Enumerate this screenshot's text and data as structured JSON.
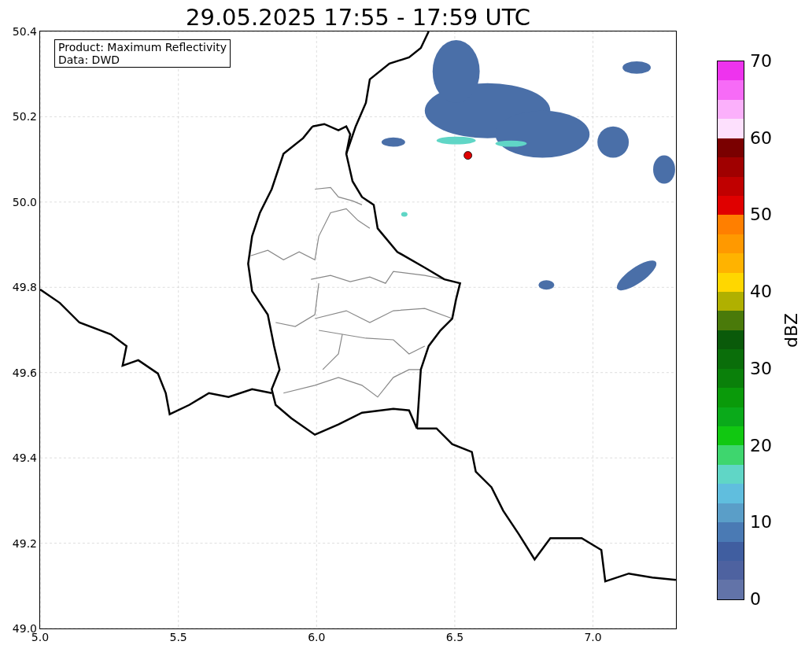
{
  "title": "29.05.2025 17:55 - 17:59 UTC",
  "annotation": [
    "Product: Maximum Reflectivity",
    "Data: DWD"
  ],
  "y_ticks": [
    "50.4",
    "50.2",
    "50.0",
    "49.8",
    "49.6",
    "49.4",
    "49.2",
    "49.0"
  ],
  "x_ticks": [
    "5.0",
    "5.5",
    "6.0",
    "6.5",
    "7.0"
  ],
  "colorbar": {
    "label": "dBZ",
    "ticks": [
      "70",
      "60",
      "50",
      "40",
      "30",
      "20",
      "10",
      "0"
    ],
    "bins": [
      {
        "color": "#ee33ee"
      },
      {
        "color": "#f76bf7"
      },
      {
        "color": "#fbb0fb"
      },
      {
        "color": "#fde0fd"
      },
      {
        "color": "#7a0000"
      },
      {
        "color": "#a00000"
      },
      {
        "color": "#c00000"
      },
      {
        "color": "#e00000"
      },
      {
        "color": "#ff7f00"
      },
      {
        "color": "#ff9900"
      },
      {
        "color": "#ffb300"
      },
      {
        "color": "#ffd700"
      },
      {
        "color": "#b0b000"
      },
      {
        "color": "#4a7a0a"
      },
      {
        "color": "#0a5a0a"
      },
      {
        "color": "#0a6e0a"
      },
      {
        "color": "#0a800a"
      },
      {
        "color": "#0a9a0a"
      },
      {
        "color": "#0aaa1a"
      },
      {
        "color": "#11c811"
      },
      {
        "color": "#3ed66e"
      },
      {
        "color": "#60d6c6"
      },
      {
        "color": "#60bede"
      },
      {
        "color": "#5a9ec8"
      },
      {
        "color": "#4a7ab4"
      },
      {
        "color": "#405ea0"
      },
      {
        "color": "#4e62a0"
      },
      {
        "color": "#6273a8"
      }
    ]
  }
}
